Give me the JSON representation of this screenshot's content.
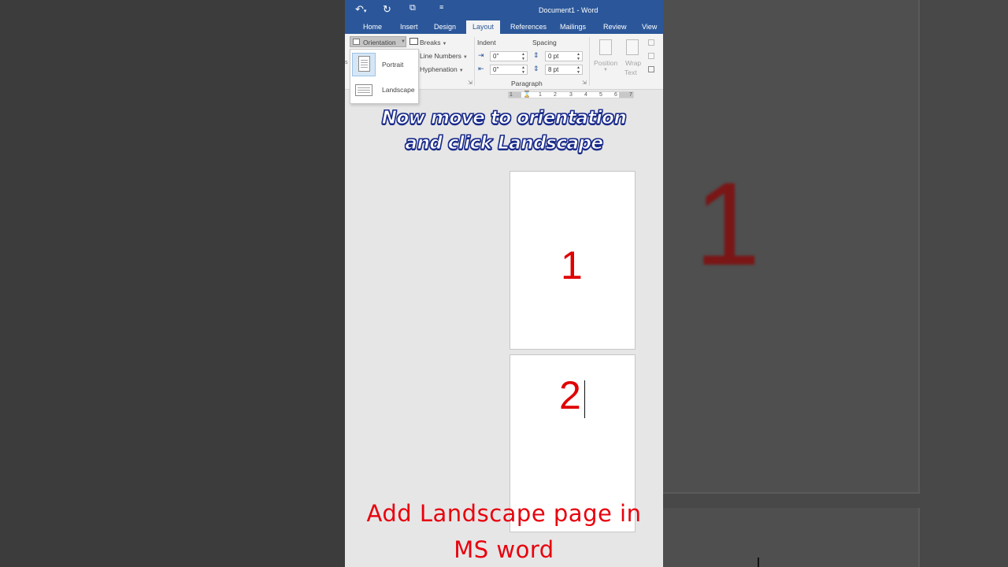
{
  "window": {
    "title": "Document1 - Word",
    "qat": {
      "undo_icon": "undo-icon",
      "redo_icon": "redo-icon",
      "touch_icon": "touch-mode-icon",
      "customize_icon": "customize-qat-icon"
    }
  },
  "tabs": [
    {
      "label": "Home",
      "active": false
    },
    {
      "label": "Insert",
      "active": false
    },
    {
      "label": "Design",
      "active": false
    },
    {
      "label": "Layout",
      "active": true
    },
    {
      "label": "References",
      "active": false
    },
    {
      "label": "Mailings",
      "active": false
    },
    {
      "label": "Review",
      "active": false
    },
    {
      "label": "View",
      "active": false
    }
  ],
  "ribbon": {
    "orientation_label": "Orientation",
    "breaks_label": "Breaks",
    "line_numbers_label": "Line Numbers",
    "hyphenation_label": "Hyphenation",
    "indent_label": "Indent",
    "spacing_label": "Spacing",
    "indent_left_value": "0\"",
    "indent_right_value": "0\"",
    "spacing_before_value": "0 pt",
    "spacing_after_value": "8 pt",
    "paragraph_group_label": "Paragraph",
    "position_label": "Position",
    "wrap_text_label_1": "Wrap",
    "wrap_text_label_2": "Text"
  },
  "orientation_menu": {
    "items": [
      {
        "label": "Portrait",
        "selected": true,
        "icon": "portrait-page-icon"
      },
      {
        "label": "Landscape",
        "selected": false,
        "icon": "landscape-page-icon"
      }
    ]
  },
  "ruler": {
    "labels": [
      "1",
      "1",
      "2",
      "3",
      "4",
      "5",
      "6",
      "7"
    ]
  },
  "document": {
    "page1_text": "1",
    "page2_text": "2"
  },
  "overlay": {
    "headline_line1": "Now move to orientation",
    "headline_line2": "and click Landscape",
    "caption_line1": "Add Landscape page in",
    "caption_line2": "MS word"
  },
  "background": {
    "blurred_number": "1"
  },
  "colors": {
    "word_blue": "#2b579a",
    "page_number_red": "#e00000",
    "caption_red": "#e8000c",
    "headline_outline": "#1a2b8a"
  }
}
